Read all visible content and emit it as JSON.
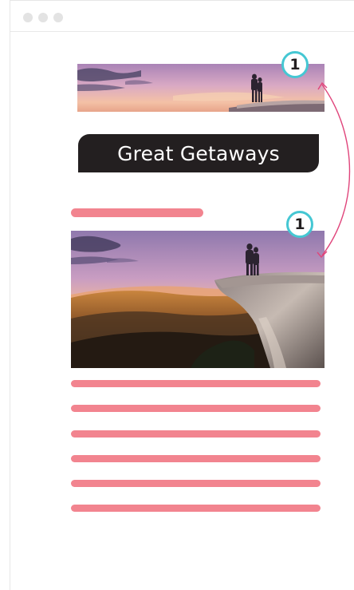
{
  "window": {
    "controls": [
      "dot",
      "dot",
      "dot"
    ]
  },
  "banner": {
    "title": "Great Getaways"
  },
  "badges": {
    "top": "1",
    "bottom": "1"
  },
  "images": {
    "small": "mountain-cliff-couple-photo-cropped",
    "large": "mountain-cliff-couple-photo"
  },
  "colors": {
    "accent_pink": "#f2848f",
    "badge_teal": "#45c7d3",
    "banner_bg": "#231f20",
    "connector": "#e0457b"
  },
  "text_lines_count_label": ""
}
